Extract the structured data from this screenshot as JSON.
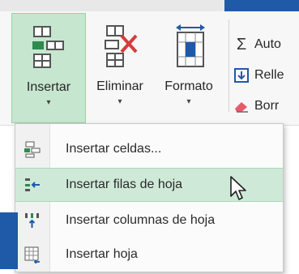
{
  "ribbon": {
    "commands": [
      {
        "label": "Insertar",
        "icon": "insert-cells-icon"
      },
      {
        "label": "Eliminar",
        "icon": "delete-cells-icon"
      },
      {
        "label": "Formato",
        "icon": "format-cells-icon"
      }
    ],
    "side_commands": [
      {
        "label": "Auto",
        "icon": "autosum-icon"
      },
      {
        "label": "Relle",
        "icon": "fill-icon"
      },
      {
        "label": "Borr",
        "icon": "clear-icon"
      }
    ]
  },
  "menu": {
    "items": [
      {
        "label": "Insertar celdas...",
        "icon": "insert-cells-icon",
        "highlighted": false
      },
      {
        "label": "Insertar filas de hoja",
        "icon": "insert-rows-icon",
        "highlighted": true
      },
      {
        "label": "Insertar columnas de hoja",
        "icon": "insert-columns-icon",
        "highlighted": false
      },
      {
        "label": "Insertar hoja",
        "icon": "insert-sheet-icon",
        "highlighted": false
      }
    ]
  },
  "colors": {
    "accent_green": "#c6e6cf",
    "highlight_green": "#cfe9d8",
    "delete_red": "#d83b3b",
    "brand_blue": "#1e5aa8"
  }
}
